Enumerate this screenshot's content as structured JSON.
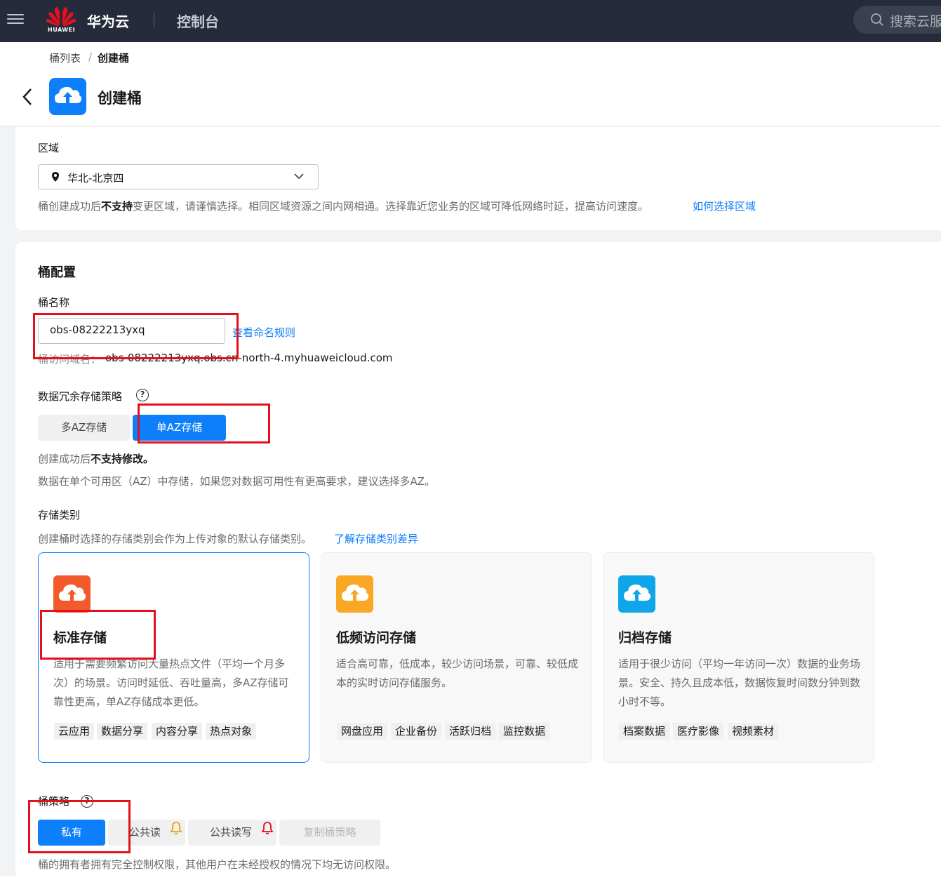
{
  "topbar": {
    "logo_text": "HUAWEI",
    "brand": "华为云",
    "console": "控制台",
    "search_placeholder": "搜索云服"
  },
  "breadcrumb": {
    "parent": "桶列表",
    "separator": "/",
    "current": "创建桶"
  },
  "page": {
    "title": "创建桶"
  },
  "region": {
    "label": "区域",
    "value": "华北-北京四",
    "hint_prefix": "桶创建成功后",
    "hint_bold": "不支持",
    "hint_suffix": "变更区域，请谨慎选择。相同区域资源之间内网相通。选择靠近您业务的区域可降低网络时延，提高访问速度。",
    "link": "如何选择区域"
  },
  "bucket_config": {
    "title": "桶配置",
    "name_label": "桶名称",
    "name_value": "obs-08222213yxq",
    "name_rule_link": "查看命名规则",
    "domain_label": "桶访问域名：",
    "domain_value": "obs-08222213yxq.obs.cn-north-4.myhuaweicloud.com"
  },
  "redundancy": {
    "label": "数据冗余存储策略",
    "help": "?",
    "options": [
      "多AZ存储",
      "单AZ存储"
    ],
    "selected": "单AZ存储",
    "note_prefix": "创建成功后",
    "note_bold": "不支持修改。",
    "desc": "数据在单个可用区（AZ）中存储，如果您对数据可用性有更高要求，建议选择多AZ。"
  },
  "storage_class": {
    "label": "存储类别",
    "hint": "创建桶时选择的存储类别会作为上传对象的默认存储类别。",
    "link": "了解存储类别差异",
    "cards": [
      {
        "title": "标准存储",
        "desc": "适用于需要频繁访问大量热点文件（平均一个月多次）的场景。访问时延低、吞吐量高，多AZ存储可靠性更高，单AZ存储成本更低。",
        "tags": [
          "云应用",
          "数据分享",
          "内容分享",
          "热点对象"
        ],
        "color": "#f25a2c",
        "icon": "cloud-upload-icon"
      },
      {
        "title": "低频访问存储",
        "desc": "适合高可靠，低成本，较少访问场景，可靠、较低成本的实时访问存储服务。",
        "tags": [
          "网盘应用",
          "企业备份",
          "活跃归档",
          "监控数据"
        ],
        "color": "#f9a825",
        "icon": "cloud-upload-icon"
      },
      {
        "title": "归档存储",
        "desc": "适用于很少访问（平均一年访问一次）数据的业务场景。安全、持久且成本低，数据恢复时间数分钟到数小时不等。",
        "tags": [
          "档案数据",
          "医疗影像",
          "视频素材"
        ],
        "color": "#0ea5e9",
        "icon": "cloud-upload-icon"
      }
    ]
  },
  "bucket_policy": {
    "label": "桶策略",
    "help": "?",
    "options": [
      "私有",
      "公共读",
      "公共读写",
      "复制桶策略"
    ],
    "selected": "私有",
    "desc": "桶的拥有者拥有完全控制权限，其他用户在未经授权的情况下均无访问权限。"
  }
}
